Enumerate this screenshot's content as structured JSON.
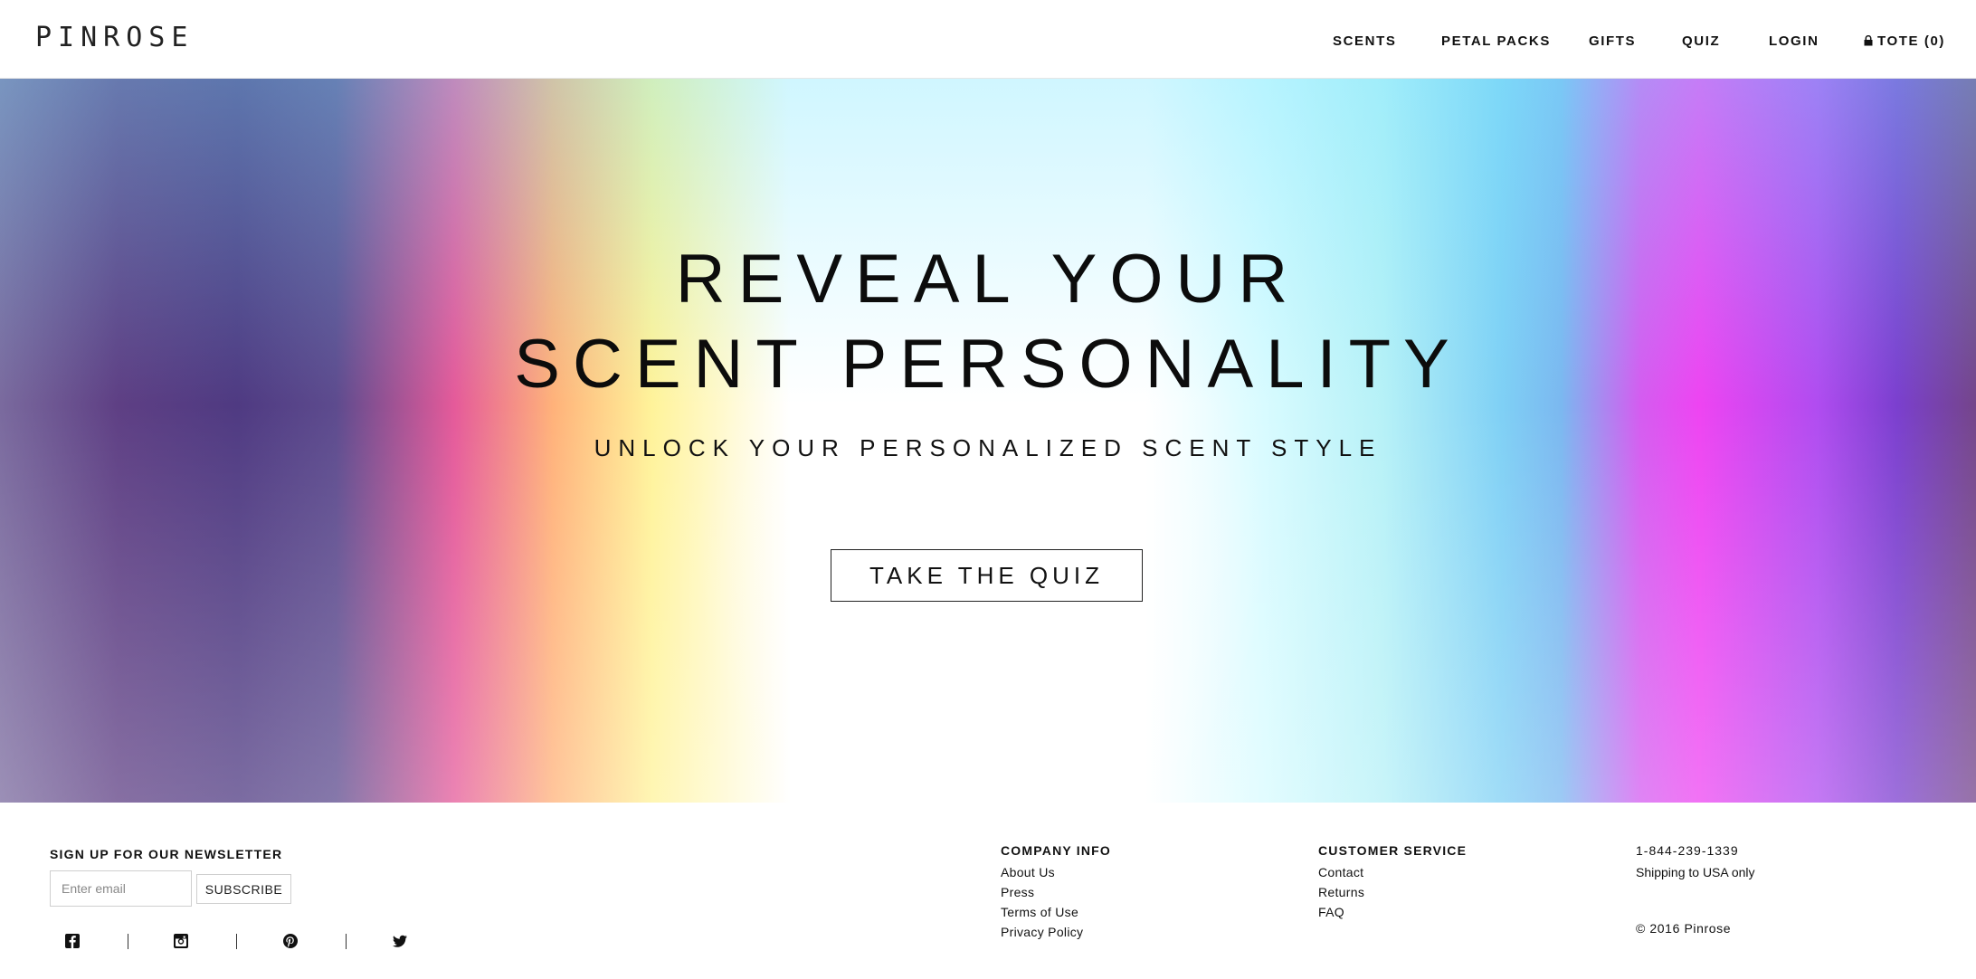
{
  "header": {
    "logo": "PINROSE",
    "nav": {
      "scents": "SCENTS",
      "petal_packs": "PETAL PACKS",
      "gifts": "GIFTS",
      "quiz": "QUIZ",
      "login": "LOGIN",
      "tote": "TOTE (0)"
    }
  },
  "hero": {
    "title_line1": "REVEAL YOUR",
    "title_line2": "SCENT PERSONALITY",
    "subtitle": "UNLOCK YOUR PERSONALIZED SCENT STYLE",
    "cta": "TAKE THE QUIZ"
  },
  "footer": {
    "newsletter": {
      "title": "SIGN UP FOR OUR NEWSLETTER",
      "placeholder": "Enter email",
      "button": "SUBSCRIBE"
    },
    "social_icons": [
      "facebook-icon",
      "instagram-icon",
      "pinterest-icon",
      "twitter-icon"
    ],
    "company": {
      "title": "COMPANY INFO",
      "links": [
        "About Us",
        "Press",
        "Terms of Use",
        "Privacy Policy"
      ]
    },
    "service": {
      "title": "CUSTOMER SERVICE",
      "links": [
        "Contact",
        "Returns",
        "FAQ"
      ]
    },
    "contact": {
      "phone": "1-844-239-1339",
      "shipping": "Shipping to USA only",
      "copyright": "© 2016 Pinrose"
    }
  }
}
